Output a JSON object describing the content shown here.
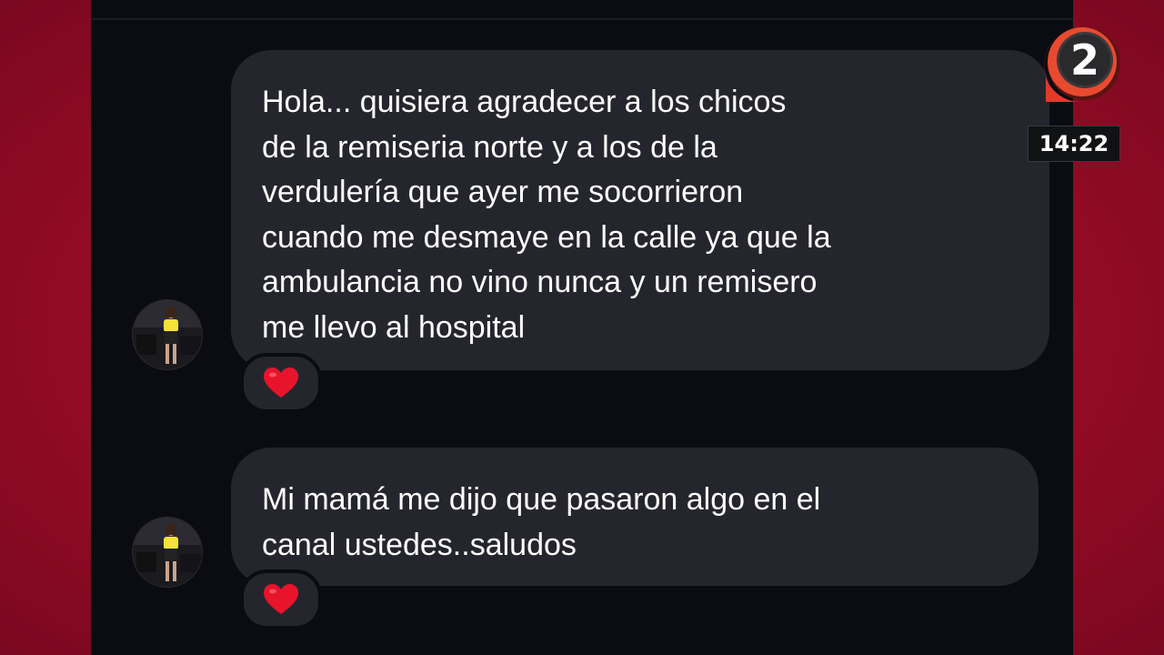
{
  "messages": [
    {
      "lines": [
        "Hola... quisiera agradecer a los chicos",
        "de la remiseria norte y a los de la",
        "verdulería que ayer me socorrieron",
        "cuando me desmaye en la calle ya que la",
        "ambulancia no vino nunca y un remisero",
        "me llevo al hospital"
      ],
      "reaction": "heart-icon"
    },
    {
      "lines": [
        "Mi mamá me dijo que pasaron algo en el",
        "canal ustedes..saludos"
      ],
      "reaction": "heart-icon"
    }
  ],
  "overlay": {
    "channel_logo": "2",
    "clock": "14:22"
  },
  "colors": {
    "background": "#a3102c",
    "chat_background": "#0b0c12",
    "bubble": "#25262d",
    "heart": "#e8142c"
  }
}
